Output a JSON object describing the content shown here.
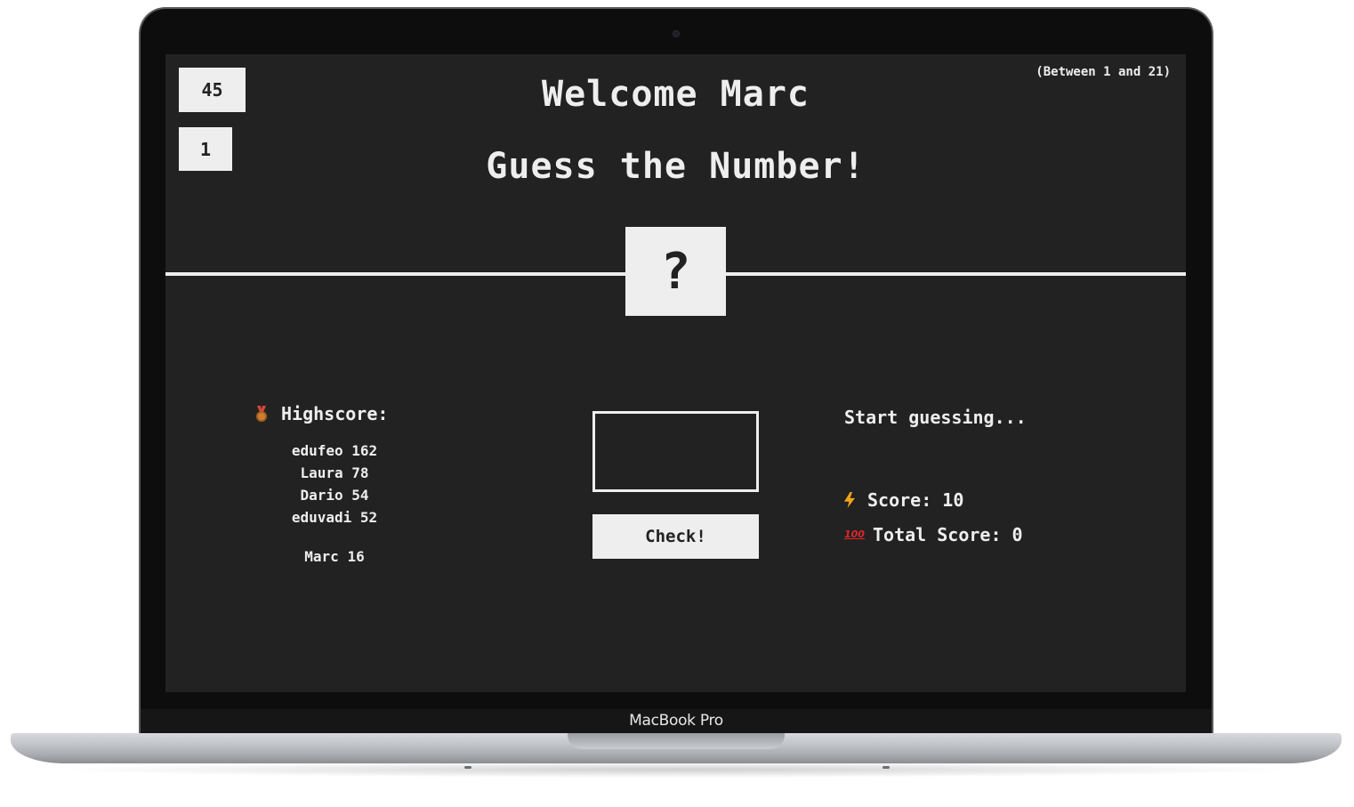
{
  "device": {
    "brand_label": "MacBook Pro"
  },
  "app": {
    "box_top": "45",
    "box_bottom": "1",
    "range_hint": "(Between 1 and 21)",
    "welcome": "Welcome Marc",
    "title": "Guess the Number!",
    "mystery": "?",
    "colors": {
      "background": "#222222",
      "foreground": "#eeeeee"
    }
  },
  "highscore": {
    "icon": "medal-icon",
    "label": "Highscore:",
    "entries": [
      "edufeo 162",
      "Laura 78",
      "Dario 54",
      "eduvadi 52"
    ],
    "current_player": "Marc 16"
  },
  "guess": {
    "input_value": "",
    "check_label": "Check!"
  },
  "status": {
    "message": "Start guessing...",
    "score_icon": "bolt-icon",
    "score_label": "Score: 10",
    "total_icon": "hundred-points-icon",
    "total_label": "Total Score: 0"
  }
}
